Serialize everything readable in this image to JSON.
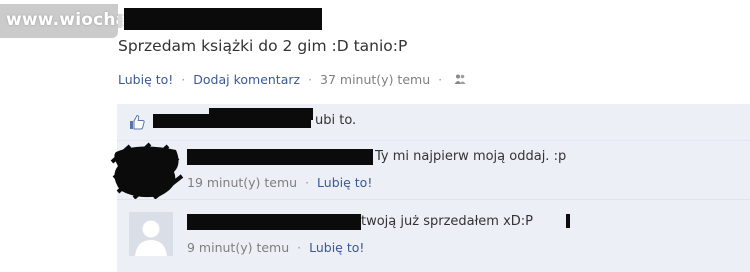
{
  "watermark": {
    "text": "www.wiocha.pl"
  },
  "status": {
    "text": "Sprzedam książki do 2 gim :D tanio:P",
    "like_label": "Lubię to!",
    "comment_label": "Dodaj komentarz",
    "time": "37 minut(y) temu",
    "separator": "·"
  },
  "likes": {
    "suffix": "ubi to."
  },
  "comments": [
    {
      "text": "Ty mi najpierw moją oddaj. :p",
      "time": "19 minut(y) temu",
      "like_label": "Lubię to!"
    },
    {
      "text": "twoją już sprzedałem xD:P",
      "time": "9 minut(y) temu",
      "like_label": "Lubię to!"
    }
  ],
  "colors": {
    "link": "#3b5998",
    "comment_bg": "#eceff5",
    "text": "#333333",
    "meta": "#7f7f7f"
  },
  "icons": {
    "audience": "people-icon",
    "like": "thumbs-up-icon",
    "avatar": "default-avatar-icon"
  }
}
